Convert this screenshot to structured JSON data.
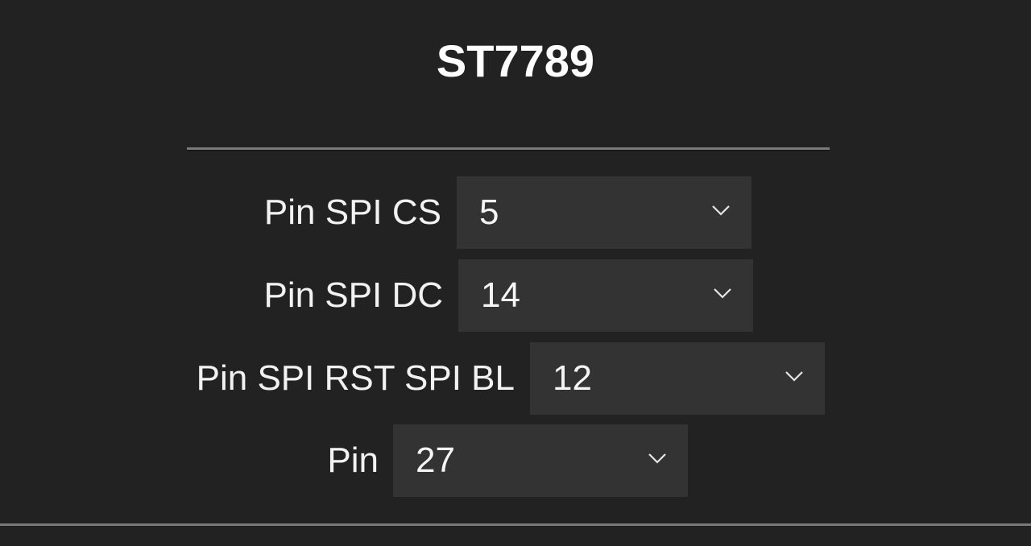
{
  "header": {
    "title": "ST7789"
  },
  "fields": [
    {
      "label": "Pin SPI CS",
      "value": "5",
      "icon": "chevron-down-icon"
    },
    {
      "label": "Pin SPI DC",
      "value": "14",
      "icon": "chevron-down-icon"
    },
    {
      "label": "Pin SPI RST SPI BL",
      "value": "12",
      "icon": "chevron-down-icon"
    },
    {
      "label": "Pin",
      "value": "27",
      "icon": "chevron-down-icon"
    }
  ],
  "colors": {
    "background": "#222222",
    "select_background": "#333333",
    "text": "#ffffff",
    "divider": "#7a7a7a"
  }
}
